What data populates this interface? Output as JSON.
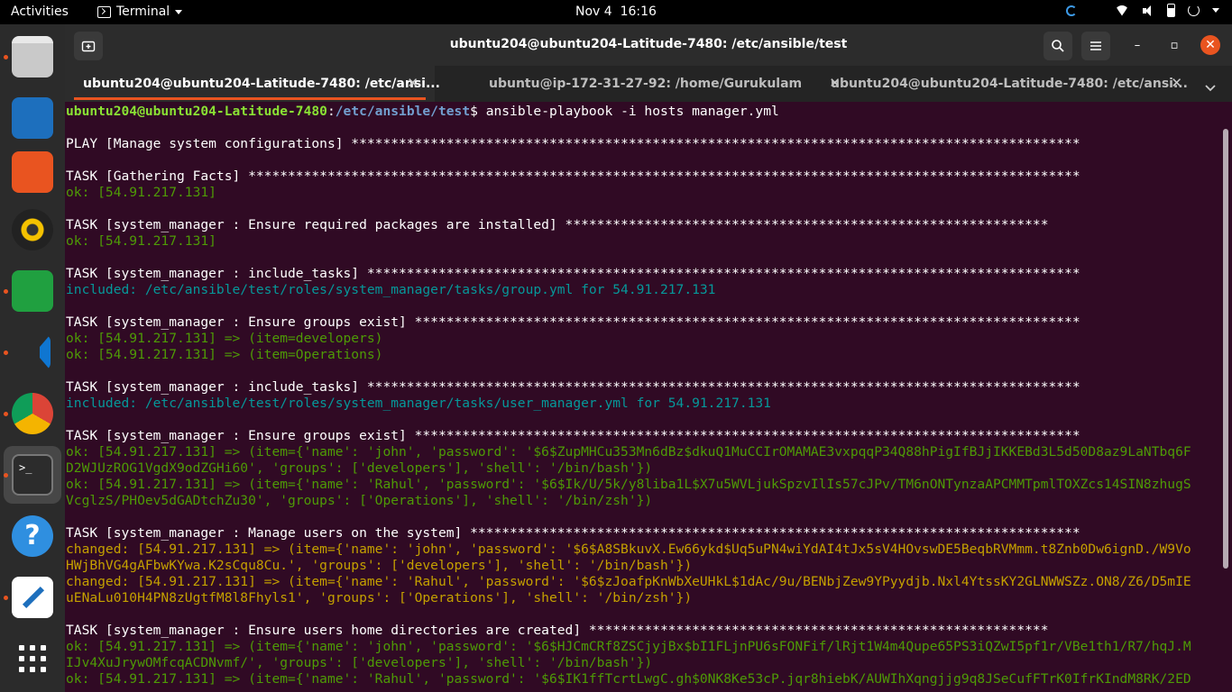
{
  "topbar": {
    "activities": "Activities",
    "app_name": "Terminal",
    "clock_date": "Nov 4",
    "clock_time": "16:16"
  },
  "dock": {
    "items": [
      {
        "name": "files-icon",
        "running": true,
        "color": "#9e9e9e"
      },
      {
        "name": "writer-icon",
        "running": false,
        "color": "#1d6fbd"
      },
      {
        "name": "software-icon",
        "running": false,
        "color": "#e95420"
      },
      {
        "name": "rhythmbox-icon",
        "running": false,
        "color": "#f5c200"
      },
      {
        "name": "calc-icon",
        "running": true,
        "color": "#20a040"
      },
      {
        "name": "vscode-icon",
        "running": true,
        "color": "#1e88e5"
      },
      {
        "name": "chrome-icon",
        "running": true,
        "color": "#db4437"
      },
      {
        "name": "terminal-icon",
        "running": true,
        "active": true,
        "color": "#2c2c2c"
      },
      {
        "name": "help-icon",
        "running": false,
        "color": "#2f8fe0"
      },
      {
        "name": "text-editor-icon",
        "running": true,
        "color": "#ffffff"
      },
      {
        "name": "show-apps-icon",
        "running": false,
        "color": "#ffffff"
      }
    ]
  },
  "window": {
    "title": "ubuntu204@ubuntu204-Latitude-7480: /etc/ansible/test",
    "new_tab_label": "+",
    "search_icon": "search-icon",
    "menu_icon": "hamburger-menu-icon",
    "minimize_label": "–",
    "maximize_label": "▫",
    "close_label": "✕"
  },
  "tabs": [
    {
      "label": "ubuntu204@ubuntu204-Latitude-7480: /etc/ansi...",
      "active": true,
      "close": "✕"
    },
    {
      "label": "ubuntu@ip-172-31-27-92: /home/Gurukulam",
      "active": false,
      "close": "✕"
    },
    {
      "label": "ubuntu204@ubuntu204-Latitude-7480: /etc/ansi...",
      "active": false,
      "close": "✕"
    }
  ],
  "tab_menu": "⌄",
  "terminal": {
    "prompt_user": "ubuntu204@ubuntu204-Latitude-7480",
    "prompt_sep": ":",
    "prompt_path": "/etc/ansible/test",
    "prompt_end": "$ ",
    "command": "ansible-playbook -i hosts manager.yml",
    "lines": [
      {
        "t": "",
        "c": "white"
      },
      {
        "t": "PLAY [Manage system configurations] ********************************************************************************************",
        "c": "white"
      },
      {
        "t": "",
        "c": "white"
      },
      {
        "t": "TASK [Gathering Facts] *********************************************************************************************************",
        "c": "white"
      },
      {
        "t": "ok: [54.91.217.131]",
        "c": "ok"
      },
      {
        "t": "",
        "c": "white"
      },
      {
        "t": "TASK [system_manager : Ensure required packages are installed] *************************************************************",
        "c": "white"
      },
      {
        "t": "ok: [54.91.217.131]",
        "c": "ok"
      },
      {
        "t": "",
        "c": "white"
      },
      {
        "t": "TASK [system_manager : include_tasks] ******************************************************************************************",
        "c": "white"
      },
      {
        "t": "included: /etc/ansible/test/roles/system_manager/tasks/group.yml for 54.91.217.131",
        "c": "included"
      },
      {
        "t": "",
        "c": "white"
      },
      {
        "t": "TASK [system_manager : Ensure groups exist] ************************************************************************************",
        "c": "white"
      },
      {
        "t": "ok: [54.91.217.131] => (item=developers)",
        "c": "ok"
      },
      {
        "t": "ok: [54.91.217.131] => (item=Operations)",
        "c": "ok"
      },
      {
        "t": "",
        "c": "white"
      },
      {
        "t": "TASK [system_manager : include_tasks] ******************************************************************************************",
        "c": "white"
      },
      {
        "t": "included: /etc/ansible/test/roles/system_manager/tasks/user_manager.yml for 54.91.217.131",
        "c": "included"
      },
      {
        "t": "",
        "c": "white"
      },
      {
        "t": "TASK [system_manager : Ensure groups exist] ************************************************************************************",
        "c": "white"
      },
      {
        "t": "ok: [54.91.217.131] => (item={'name': 'john', 'password': '$6$ZupMHCu353Mn6dBz$dkuQ1MuCCIrOMAMAE3vxpqqP34Q88hPigIfBJjIKKEBd3L5d50D8az9LaNTbq6F",
        "c": "ok"
      },
      {
        "t": "D2WJUzROG1VgdX9odZGHi60', 'groups': ['developers'], 'shell': '/bin/bash'})",
        "c": "ok"
      },
      {
        "t": "ok: [54.91.217.131] => (item={'name': 'Rahul', 'password': '$6$Ik/U/5k/y8liba1L$X7u5WVLjukSpzvIlIs57cJPv/TM6nONTynzaAPCMMTpmlTOXZcs14SIN8zhugS",
        "c": "ok"
      },
      {
        "t": "VcglzS/PHOev5dGADtchZu30', 'groups': ['Operations'], 'shell': '/bin/zsh'})",
        "c": "ok"
      },
      {
        "t": "",
        "c": "white"
      },
      {
        "t": "TASK [system_manager : Manage users on the system] *****************************************************************************",
        "c": "white"
      },
      {
        "t": "changed: [54.91.217.131] => (item={'name': 'john', 'password': '$6$A8SBkuvX.Ew66ykd$Uq5uPN4wiYdAI4tJx5sV4HOvswDE5BeqbRVMmm.t8Znb0Dw6ignD./W9Vo",
        "c": "changed"
      },
      {
        "t": "HWjBhVG4gAFbwKYwa.K2sCqu8Cu.', 'groups': ['developers'], 'shell': '/bin/bash'})",
        "c": "changed"
      },
      {
        "t": "changed: [54.91.217.131] => (item={'name': 'Rahul', 'password': '$6$zJoafpKnWbXeUHkL$1dAc/9u/BENbjZew9YPyydjb.Nxl4YtssKY2GLNWWSZz.ON8/Z6/D5mIE",
        "c": "changed"
      },
      {
        "t": "uENaLu010H4PN8zUgtfM8l8Fhyls1', 'groups': ['Operations'], 'shell': '/bin/zsh'})",
        "c": "changed"
      },
      {
        "t": "",
        "c": "white"
      },
      {
        "t": "TASK [system_manager : Ensure users home directories are created] **********************************************************",
        "c": "white"
      },
      {
        "t": "ok: [54.91.217.131] => (item={'name': 'john', 'password': '$6$HJCmCRf8ZSCjyjBx$bI1FLjnPU6sFONFif/lRjt1W4m4Qupe65PS3iQZwI5pf1r/VBe1th1/R7/hqJ.M",
        "c": "ok"
      },
      {
        "t": "IJv4XuJrywOMfcqACDNvmf/', 'groups': ['developers'], 'shell': '/bin/bash'})",
        "c": "ok"
      },
      {
        "t": "ok: [54.91.217.131] => (item={'name': 'Rahul', 'password': '$6$IK1ffTcrtLwgC.gh$0NK8Ke53cP.jqr8hiebK/AUWIhXqngjjg9q8JSeCufFTrK0IfrKIndM8RK/2ED",
        "c": "ok"
      }
    ]
  },
  "colors": {
    "terminal_bg": "#300a24",
    "ok": "#4e9a06",
    "changed": "#c4a000",
    "included": "#06989a",
    "accent": "#e95420"
  }
}
